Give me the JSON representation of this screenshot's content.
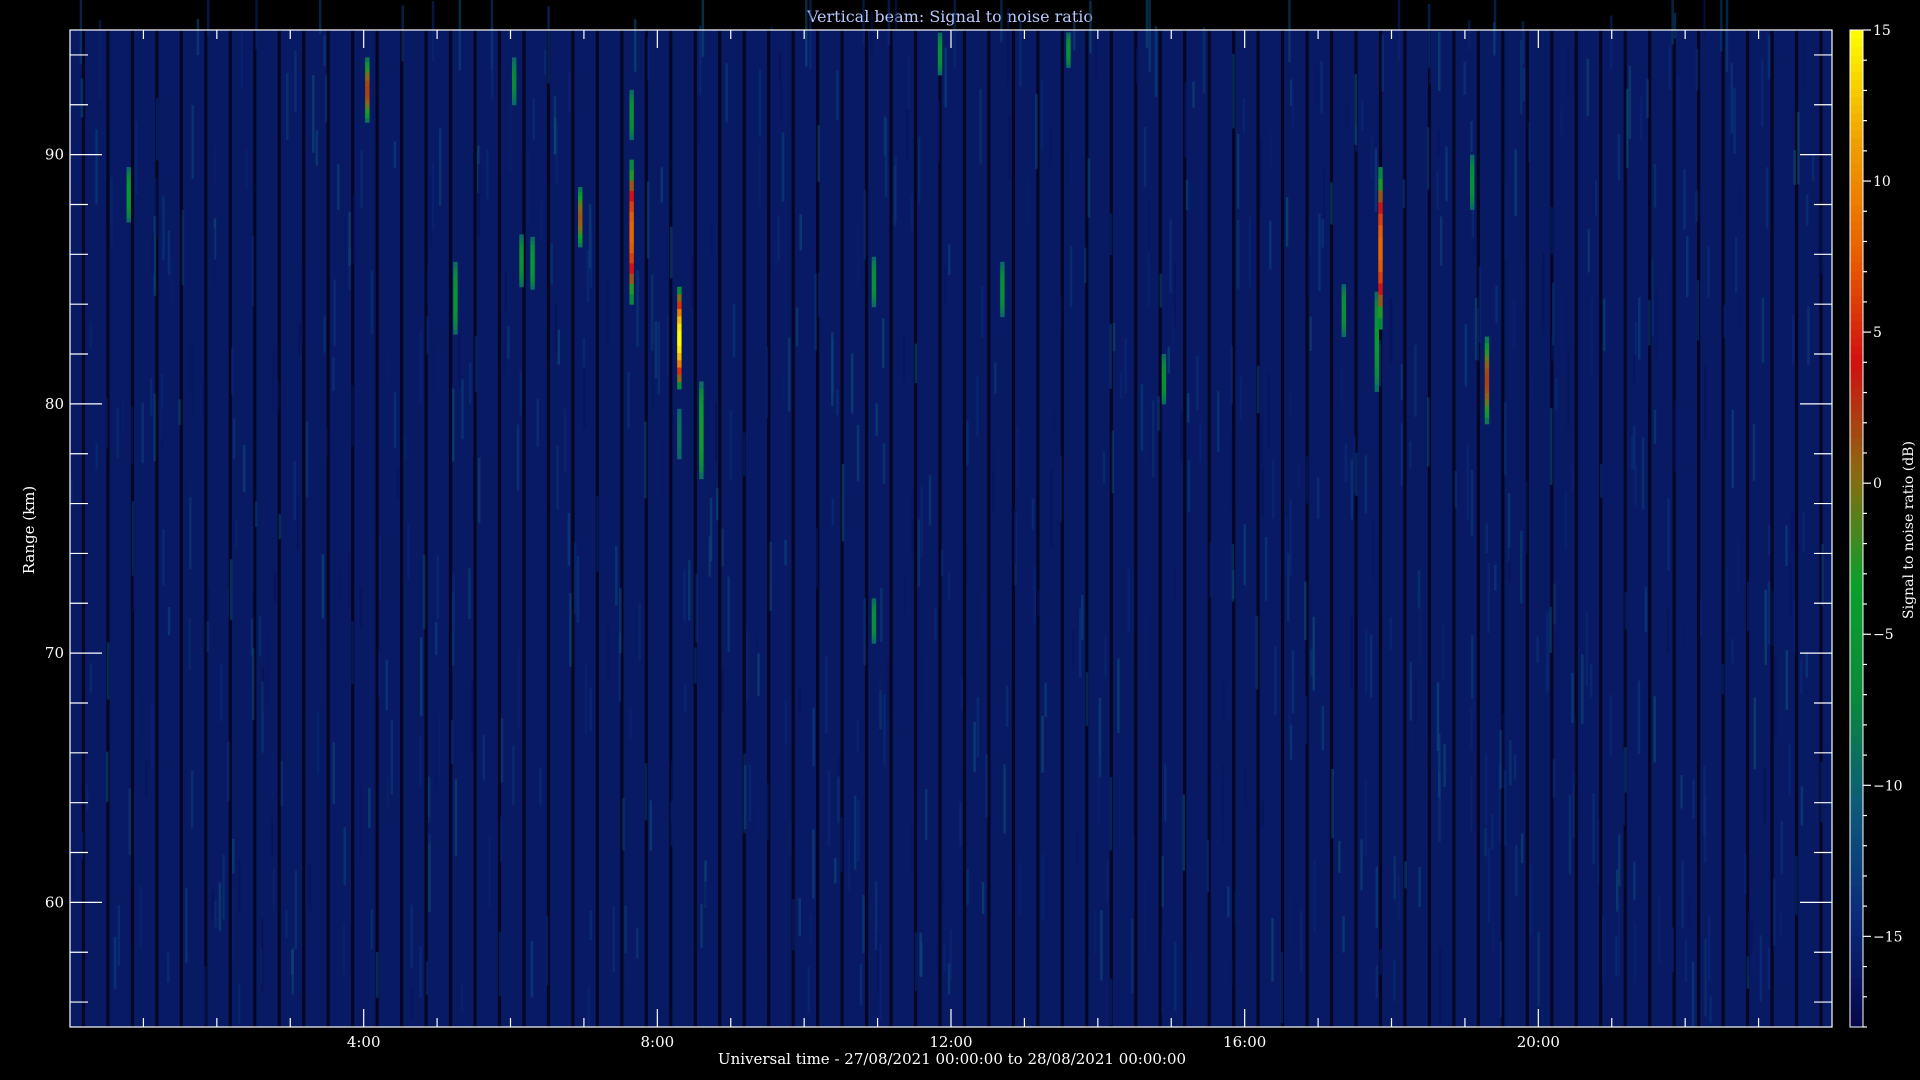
{
  "chart_data": {
    "type": "heatmap",
    "title": "Vertical beam: Signal to noise ratio",
    "xlabel": "Universal time - 27/08/2021 00:00:00 to 28/08/2021 00:00:00",
    "ylabel": "Range (km)",
    "colorbar_label": "Signal to noise ratio (dB)",
    "x_range_hours": [
      0,
      24
    ],
    "y_range_km": [
      55,
      95
    ],
    "color_range_db": [
      -18,
      15
    ],
    "x_tick_values_hours": [
      4,
      8,
      12,
      16,
      20
    ],
    "x_tick_labels": [
      "4:00",
      "8:00",
      "12:00",
      "16:00",
      "20:00"
    ],
    "y_tick_values": [
      60,
      70,
      80,
      90
    ],
    "y_tick_labels": [
      "60",
      "70",
      "80",
      "90"
    ],
    "colorbar_tick_values": [
      15,
      10,
      5,
      0,
      -5,
      -10,
      -15
    ],
    "colorbar_tick_labels": [
      "15",
      "10",
      "5",
      "0",
      "−5",
      "−10",
      "−15"
    ],
    "colormap": [
      "#06064a",
      "#0a2a7a",
      "#0c5a7a",
      "#0a8a3a",
      "#0aa02a",
      "#8a6a10",
      "#d01010",
      "#e86000",
      "#f0a000",
      "#ffff00"
    ],
    "background_db": -16,
    "echoes": [
      {
        "time_h": 0.8,
        "range_bottom_km": 87.3,
        "range_top_km": 89.5,
        "peak_db": -5
      },
      {
        "time_h": 4.05,
        "range_bottom_km": 91.3,
        "range_top_km": 93.9,
        "peak_db": 2
      },
      {
        "time_h": 5.25,
        "range_bottom_km": 82.8,
        "range_top_km": 85.7,
        "peak_db": -5
      },
      {
        "time_h": 6.05,
        "range_bottom_km": 92.0,
        "range_top_km": 93.9,
        "peak_db": -7
      },
      {
        "time_h": 6.15,
        "range_bottom_km": 84.7,
        "range_top_km": 86.8,
        "peak_db": -6
      },
      {
        "time_h": 6.3,
        "range_bottom_km": 84.6,
        "range_top_km": 86.7,
        "peak_db": -5
      },
      {
        "time_h": 6.95,
        "range_bottom_km": 86.3,
        "range_top_km": 88.7,
        "peak_db": 1
      },
      {
        "time_h": 7.65,
        "range_bottom_km": 84.0,
        "range_top_km": 89.8,
        "peak_db": 8
      },
      {
        "time_h": 7.65,
        "range_bottom_km": 90.6,
        "range_top_km": 92.6,
        "peak_db": -6
      },
      {
        "time_h": 8.3,
        "range_bottom_km": 80.6,
        "range_top_km": 84.7,
        "peak_db": 15
      },
      {
        "time_h": 8.3,
        "range_bottom_km": 77.8,
        "range_top_km": 79.8,
        "peak_db": -9
      },
      {
        "time_h": 8.6,
        "range_bottom_km": 77.0,
        "range_top_km": 80.9,
        "peak_db": -3
      },
      {
        "time_h": 10.95,
        "range_bottom_km": 83.9,
        "range_top_km": 85.9,
        "peak_db": -6
      },
      {
        "time_h": 10.95,
        "range_bottom_km": 70.4,
        "range_top_km": 72.2,
        "peak_db": -6
      },
      {
        "time_h": 11.85,
        "range_bottom_km": 93.2,
        "range_top_km": 94.9,
        "peak_db": -6
      },
      {
        "time_h": 12.7,
        "range_bottom_km": 83.5,
        "range_top_km": 85.7,
        "peak_db": -6
      },
      {
        "time_h": 13.6,
        "range_bottom_km": 93.5,
        "range_top_km": 94.9,
        "peak_db": -6
      },
      {
        "time_h": 14.9,
        "range_bottom_km": 80.0,
        "range_top_km": 82.0,
        "peak_db": -6
      },
      {
        "time_h": 17.35,
        "range_bottom_km": 82.7,
        "range_top_km": 84.8,
        "peak_db": -6
      },
      {
        "time_h": 17.8,
        "range_bottom_km": 80.5,
        "range_top_km": 84.5,
        "peak_db": -5
      },
      {
        "time_h": 17.85,
        "range_bottom_km": 83.0,
        "range_top_km": 89.5,
        "peak_db": 8
      },
      {
        "time_h": 19.1,
        "range_bottom_km": 87.8,
        "range_top_km": 90.0,
        "peak_db": -6
      },
      {
        "time_h": 19.3,
        "range_bottom_km": 79.2,
        "range_top_km": 82.7,
        "peak_db": 2
      }
    ]
  }
}
